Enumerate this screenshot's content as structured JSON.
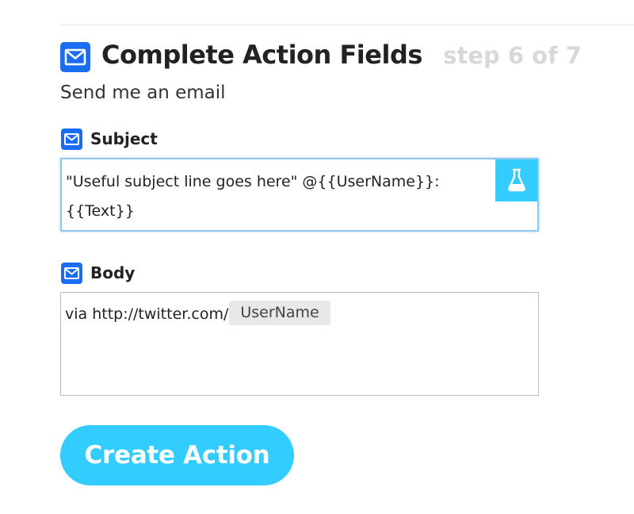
{
  "header": {
    "title": "Complete Action Fields",
    "step": "step 6 of 7",
    "icon": "mail-icon"
  },
  "action": {
    "subtitle": "Send me an email"
  },
  "fields": {
    "subject": {
      "label": "Subject",
      "icon": "mail-icon",
      "value_line1": "\"Useful subject line goes here\" @{{UserName}}:",
      "value_line2": "{{Text}}",
      "ingredient_button_icon": "flask-icon"
    },
    "body": {
      "label": "Body",
      "icon": "mail-icon",
      "text_prefix": "via http://twitter.com/",
      "ingredient": "UserName"
    }
  },
  "create_button": {
    "label": "Create Action"
  },
  "colors": {
    "accent": "#33ccff",
    "mail_icon": "#1a6df0",
    "step_text": "#d8d8d8",
    "focus_border": "#8ec6ee"
  }
}
